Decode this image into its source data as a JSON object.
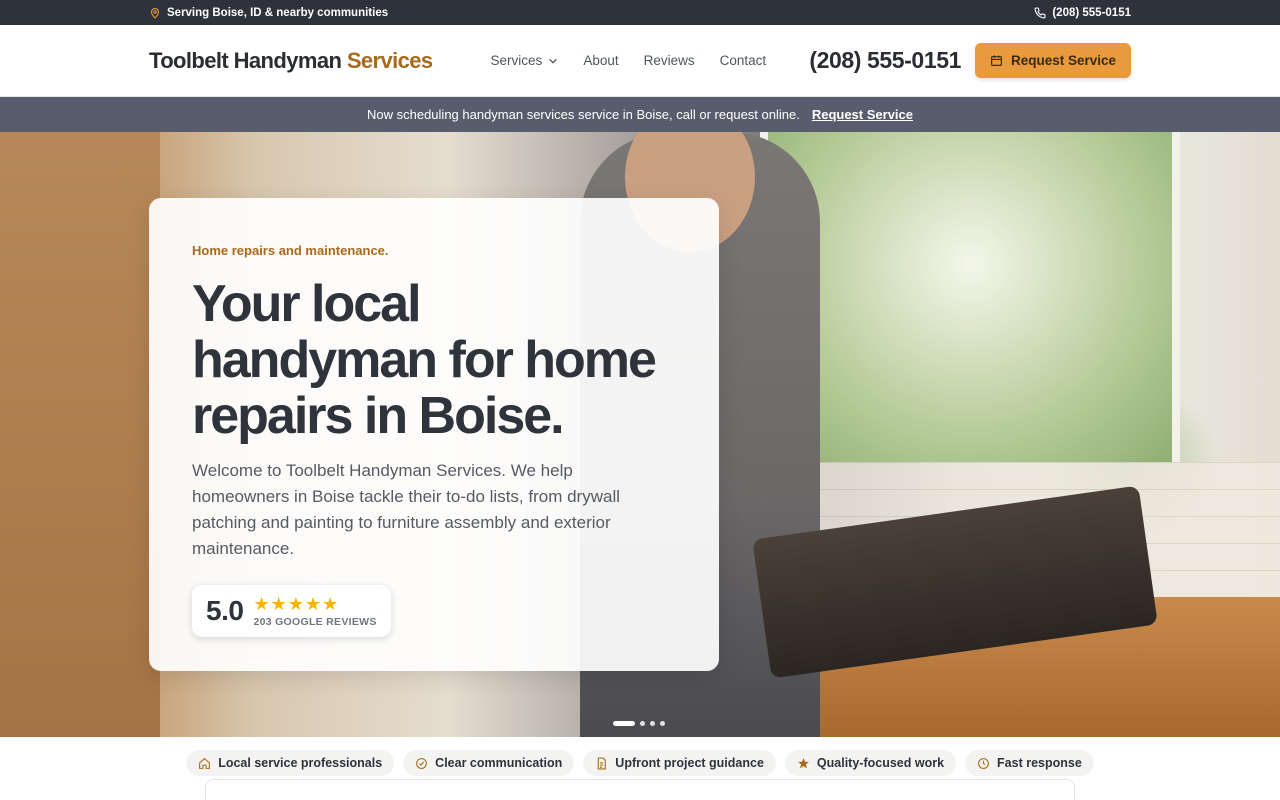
{
  "topbar": {
    "location": "Serving Boise, ID & nearby communities",
    "phone": "(208) 555-0151"
  },
  "header": {
    "logo_main": "Toolbelt Handyman ",
    "logo_accent": "Services",
    "nav": [
      {
        "label": "Services"
      },
      {
        "label": "About"
      },
      {
        "label": "Reviews"
      },
      {
        "label": "Contact"
      }
    ],
    "phone": "(208) 555-0151",
    "cta": "Request Service"
  },
  "announcement": {
    "text": "Now scheduling handyman services service in Boise, call or request online.",
    "link": "Request Service"
  },
  "hero": {
    "eyebrow": "Home repairs and maintenance.",
    "headline": "Your local handyman for home repairs in Boise.",
    "intro": "Welcome to Toolbelt Handyman Services. We help homeowners in Boise tackle their to-do lists, from drywall patching and painting to furniture assembly and exterior maintenance.",
    "rating_score": "5.0",
    "rating_stars": 5,
    "rating_text": "203 GOOGLE REVIEWS",
    "slides_total": 4,
    "slide_active": 1
  },
  "features": [
    {
      "label": "Local service professionals",
      "icon": "home-icon"
    },
    {
      "label": "Clear communication",
      "icon": "check-circle-icon"
    },
    {
      "label": "Upfront project guidance",
      "icon": "document-icon"
    },
    {
      "label": "Quality-focused work",
      "icon": "star-icon"
    },
    {
      "label": "Fast response",
      "icon": "clock-icon"
    }
  ],
  "colors": {
    "accent": "#e89a3c",
    "brand_text": "#a86a1a",
    "topbar": "#2e323b",
    "announce": "#575d6c"
  }
}
